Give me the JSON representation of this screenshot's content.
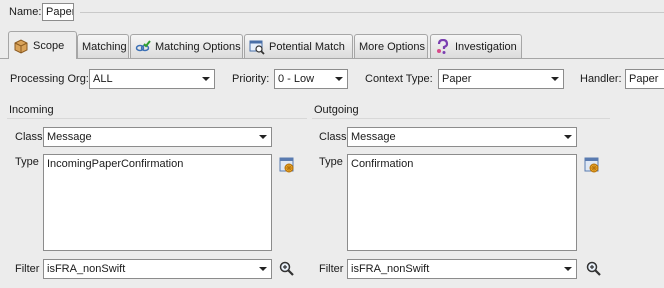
{
  "name": {
    "label": "Name:",
    "value": "Paper"
  },
  "tabs": [
    {
      "label": "Scope",
      "icon": "package-icon",
      "active": true
    },
    {
      "label": "Matching",
      "icon": "",
      "active": false
    },
    {
      "label": "Matching Options",
      "icon": "link-check-icon",
      "active": false
    },
    {
      "label": "Potential Match",
      "icon": "search-window-icon",
      "active": false
    },
    {
      "label": "More Options",
      "icon": "",
      "active": false
    },
    {
      "label": "Investigation",
      "icon": "question-icon",
      "active": false
    }
  ],
  "toolbar": {
    "processing_org": {
      "label": "Processing Org:",
      "value": "ALL"
    },
    "priority": {
      "label": "Priority:",
      "value": "0 - Low"
    },
    "context_type": {
      "label": "Context Type:",
      "value": "Paper"
    },
    "handler": {
      "label": "Handler:",
      "value": "Paper"
    }
  },
  "incoming": {
    "title": "Incoming",
    "class_label": "Class",
    "class_value": "Message",
    "type_label": "Type",
    "type_value": "IncomingPaperConfirmation",
    "filter_label": "Filter",
    "filter_value": "isFRA_nonSwift"
  },
  "outgoing": {
    "title": "Outgoing",
    "class_label": "Class",
    "class_value": "Message",
    "type_label": "Type",
    "type_value": "Confirmation",
    "filter_label": "Filter",
    "filter_value": "isFRA_nonSwift"
  },
  "colors": {
    "background": "#ececec",
    "border": "#8c8c8c",
    "tab_border": "#a6a6a6"
  }
}
